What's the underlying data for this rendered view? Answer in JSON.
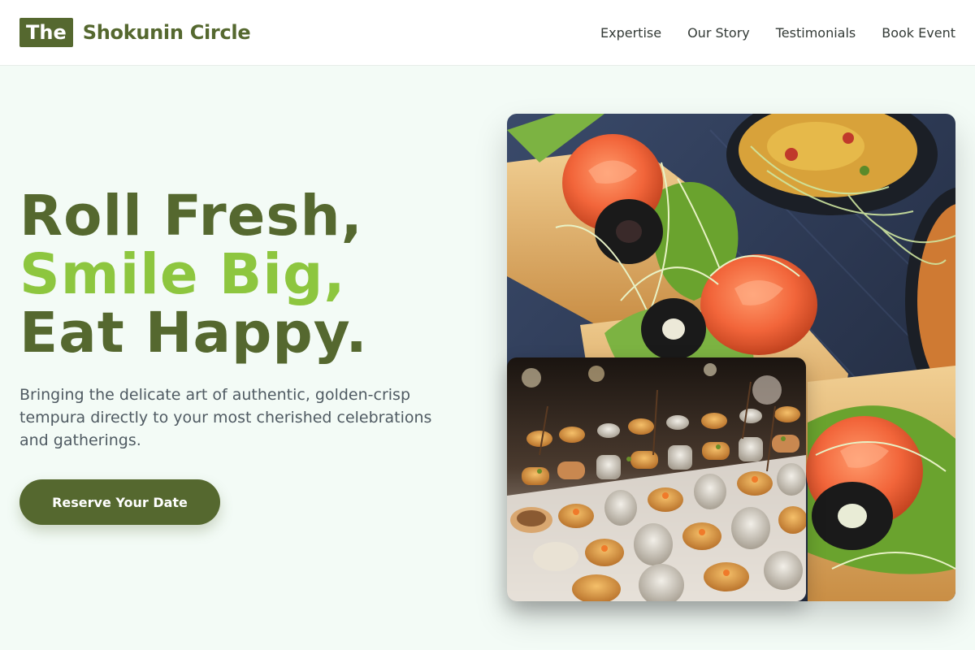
{
  "header": {
    "logo_badge": "The",
    "logo_text": "Shokunin Circle",
    "nav": [
      "Expertise",
      "Our Story",
      "Testimonials",
      "Book Event"
    ]
  },
  "hero": {
    "line1": "Roll Fresh,",
    "line2": "Smile Big,",
    "line3": "Eat Happy.",
    "subtitle": "Bringing the delicate art of authentic, golden-crisp tempura directly to your most cherished celebrations and gatherings.",
    "cta_label": "Reserve Your Date"
  },
  "images": {
    "main": "salmon-rose-canapes-photo",
    "inset": "catering-buffet-appetizers-photo"
  },
  "colors": {
    "brand_dark": "#55682f",
    "brand_light": "#8dc63f",
    "background": "#f3fbf6"
  }
}
